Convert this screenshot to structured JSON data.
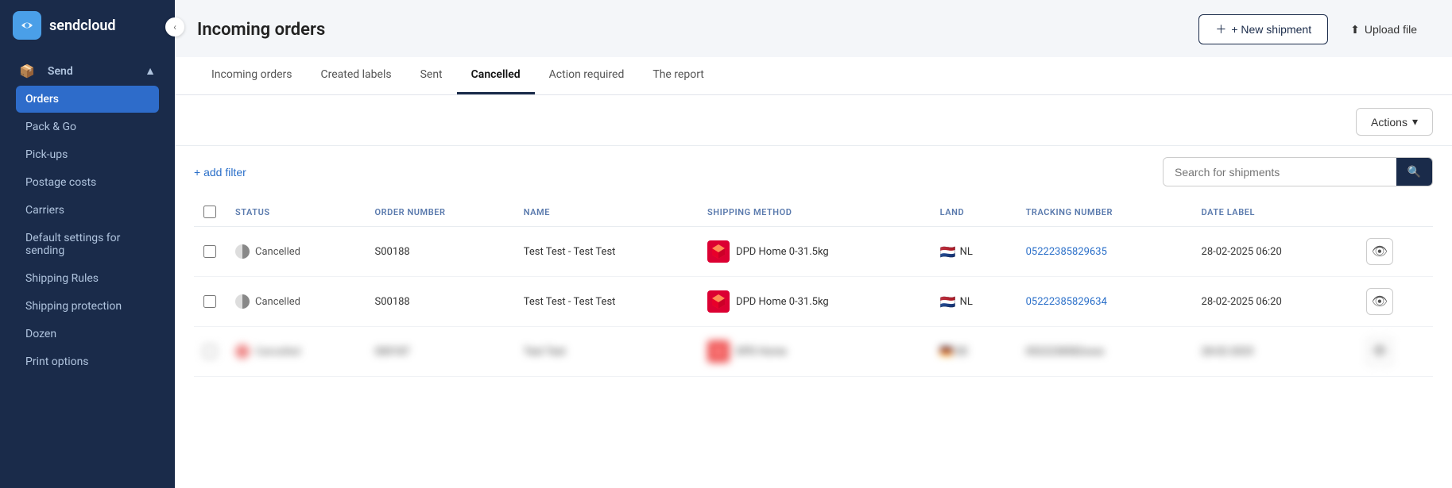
{
  "app": {
    "logo_text": "sendcloud"
  },
  "sidebar": {
    "collapse_icon": "‹",
    "send_section_label": "Send",
    "items": [
      {
        "id": "orders",
        "label": "Orders",
        "active": true
      },
      {
        "id": "pack-go",
        "label": "Pack & Go",
        "active": false
      },
      {
        "id": "pick-ups",
        "label": "Pick-ups",
        "active": false
      },
      {
        "id": "postage-costs",
        "label": "Postage costs",
        "active": false
      },
      {
        "id": "carriers",
        "label": "Carriers",
        "active": false
      },
      {
        "id": "default-settings",
        "label": "Default settings for sending",
        "active": false
      },
      {
        "id": "shipping-rules",
        "label": "Shipping Rules",
        "active": false
      },
      {
        "id": "shipping-protection",
        "label": "Shipping protection",
        "active": false
      },
      {
        "id": "dozen",
        "label": "Dozen",
        "active": false
      },
      {
        "id": "print-options",
        "label": "Print options",
        "active": false
      }
    ]
  },
  "header": {
    "page_title": "Incoming orders",
    "new_shipment_label": "+ New shipment",
    "upload_file_label": "Upload file"
  },
  "tabs": [
    {
      "id": "incoming-orders",
      "label": "Incoming orders",
      "active": false
    },
    {
      "id": "created-labels",
      "label": "Created labels",
      "active": false
    },
    {
      "id": "sent",
      "label": "Sent",
      "active": false
    },
    {
      "id": "cancelled",
      "label": "Cancelled",
      "active": true
    },
    {
      "id": "action-required",
      "label": "Action required",
      "active": false
    },
    {
      "id": "the-report",
      "label": "The report",
      "active": false
    }
  ],
  "actions_button": "Actions",
  "add_filter_label": "+ add filter",
  "search_placeholder": "Search for shipments",
  "table": {
    "columns": [
      {
        "id": "checkbox",
        "label": ""
      },
      {
        "id": "status",
        "label": "STATUS"
      },
      {
        "id": "order-number",
        "label": "ORDER NUMBER"
      },
      {
        "id": "name",
        "label": "NAME"
      },
      {
        "id": "shipping-method",
        "label": "SHIPPING METHOD"
      },
      {
        "id": "land",
        "label": "LAND"
      },
      {
        "id": "tracking-number",
        "label": "TRACKING NUMBER"
      },
      {
        "id": "date-label",
        "label": "DATE LABEL"
      },
      {
        "id": "actions",
        "label": ""
      }
    ],
    "rows": [
      {
        "id": "row1",
        "status": "Cancelled",
        "order_number": "S00188",
        "name": "Test Test - Test Test",
        "shipping_method": "DPD Home 0-31.5kg",
        "land_flag": "🇳🇱",
        "land_code": "NL",
        "tracking_number": "05222385829635",
        "date_label": "28-02-2025 06:20",
        "blurred": false
      },
      {
        "id": "row2",
        "status": "Cancelled",
        "order_number": "S00188",
        "name": "Test Test - Test Test",
        "shipping_method": "DPD Home 0-31.5kg",
        "land_flag": "🇳🇱",
        "land_code": "NL",
        "tracking_number": "05222385829634",
        "date_label": "28-02-2025 06:20",
        "blurred": false
      },
      {
        "id": "row3",
        "status": "",
        "order_number": "",
        "name": "",
        "shipping_method": "",
        "land_flag": "",
        "land_code": "",
        "tracking_number": "",
        "date_label": "",
        "blurred": true
      }
    ]
  }
}
